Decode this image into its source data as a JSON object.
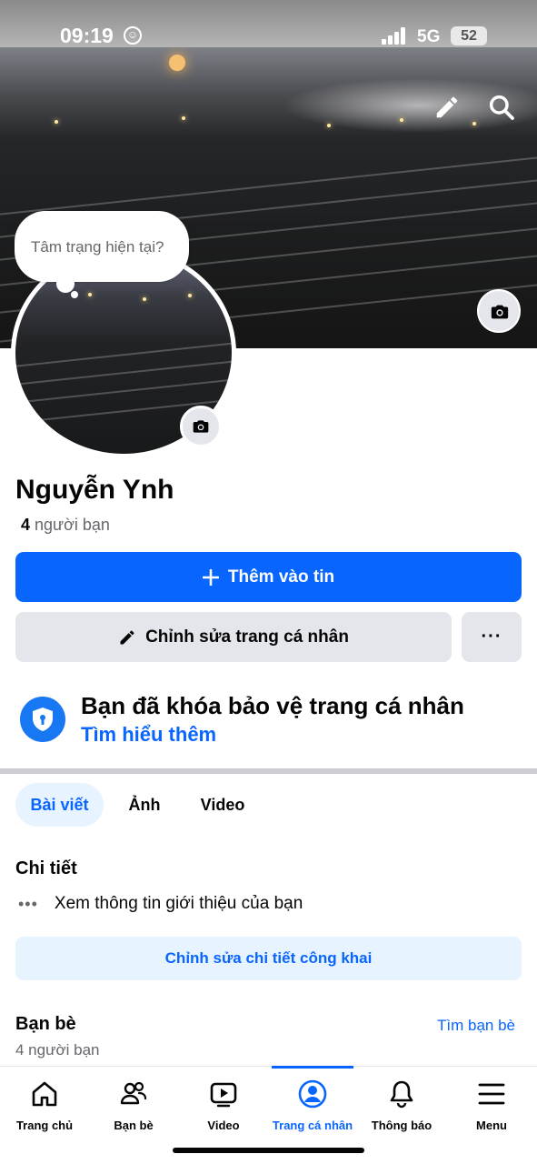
{
  "status_bar": {
    "time": "09:19",
    "network": "5G",
    "battery": "52"
  },
  "profile": {
    "thought_placeholder": "Tâm trạng hiện tại?",
    "name": "Nguyễn Ynh",
    "friend_count": "4",
    "friend_count_suffix": "người bạn"
  },
  "actions": {
    "add_story": "Thêm vào tin",
    "edit_profile": "Chỉnh sửa trang cá nhân",
    "more": "···"
  },
  "profile_lock": {
    "title": "Bạn đã khóa bảo vệ trang cá nhân",
    "link": "Tìm hiểu thêm"
  },
  "tabs": [
    {
      "label": "Bài viết",
      "active": true
    },
    {
      "label": "Ảnh",
      "active": false
    },
    {
      "label": "Video",
      "active": false
    }
  ],
  "details": {
    "title": "Chi tiết",
    "intro": "Xem thông tin giới thiệu của bạn",
    "edit_public": "Chỉnh sửa chi tiết công khai"
  },
  "friends": {
    "title": "Bạn bè",
    "find": "Tìm bạn bè",
    "count_text": "4 người bạn"
  },
  "bottom_nav": [
    {
      "label": "Trang chủ",
      "icon": "home-icon"
    },
    {
      "label": "Bạn bè",
      "icon": "friends-icon"
    },
    {
      "label": "Video",
      "icon": "video-icon"
    },
    {
      "label": "Trang cá nhân",
      "icon": "profile-icon",
      "active": true
    },
    {
      "label": "Thông báo",
      "icon": "bell-icon"
    },
    {
      "label": "Menu",
      "icon": "menu-icon"
    }
  ],
  "colors": {
    "accent": "#0866ff",
    "button_gray": "#e4e6eb",
    "light_blue": "#e7f3ff"
  }
}
